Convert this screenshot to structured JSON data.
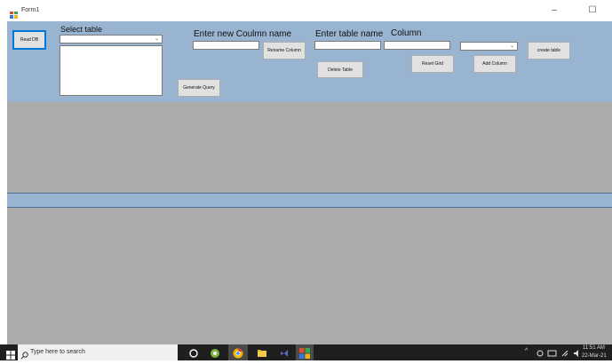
{
  "window": {
    "title": "Form1",
    "minimize": "–",
    "maximize": "☐"
  },
  "form": {
    "read_db": "Read DB",
    "select_table_label": "Select table",
    "new_column_label": "Enter new Coulmn name",
    "rename_column": "Rename Column",
    "table_name_label": "Enter table name",
    "column_label": "Column",
    "delete_table": "Delete Table",
    "reset_grid": "Reset Grid",
    "add_column": "Add Column",
    "create_table": "create table",
    "generate_query": "Generate Query"
  },
  "taskbar": {
    "search_placeholder": "Type here to search",
    "time": "11:51 AM",
    "date": "22-Mar-21"
  },
  "colors": {
    "panel": "#99b4d1",
    "grid": "#ababab",
    "taskbar": "#1f1f1f"
  }
}
